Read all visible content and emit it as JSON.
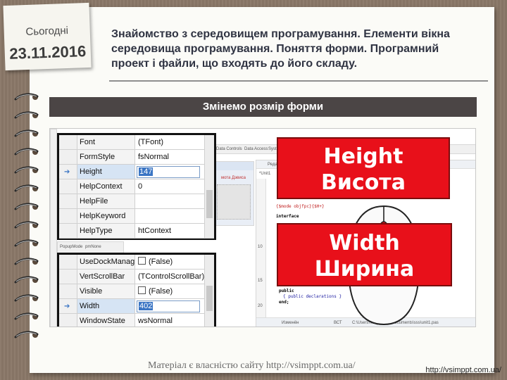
{
  "note": {
    "label": "Сьогодні",
    "date": "23.11.2016"
  },
  "title": "Знайомство з середовищем програмування. Елементи вікна середовища програмування. Поняття форми. Програмний проект і файли, що входять до його складу.",
  "subtitle": "Змінемо розмір форми",
  "inspector_top": {
    "rows": [
      {
        "name": "Font",
        "value": "(TFont)"
      },
      {
        "name": "FormStyle",
        "value": "fsNormal"
      },
      {
        "name": "Height",
        "value": "147",
        "selected": true
      },
      {
        "name": "HelpContext",
        "value": "0"
      },
      {
        "name": "HelpFile",
        "value": ""
      },
      {
        "name": "HelpKeyword",
        "value": ""
      },
      {
        "name": "HelpType",
        "value": "htContext"
      }
    ]
  },
  "inspector_bottom": {
    "rows": [
      {
        "name": "UseDockManag",
        "value": "(False)",
        "checkbox": true
      },
      {
        "name": "VertScrollBar",
        "value": "(TControlScrollBar)"
      },
      {
        "name": "Visible",
        "value": "(False)",
        "checkbox": true
      },
      {
        "name": "Width",
        "value": "402",
        "selected": true
      },
      {
        "name": "WindowState",
        "value": "wsNormal"
      }
    ]
  },
  "callouts": {
    "height": {
      "line1": "Height",
      "line2": "Висота"
    },
    "width": {
      "line1": "Width",
      "line2": "Ширина"
    }
  },
  "ide": {
    "tabs": [
      "Data Controls",
      "Data Access",
      "Syste"
    ],
    "popup_mode_label": "PopupMode",
    "popup_mode_value": "pmNone",
    "form_caption": "мота Дэвиса",
    "editor_caption": "Редакто",
    "unit_tab": "*Unit1",
    "code_lines": [
      "{$mode objfpc}{$H+}",
      "interface",
      "public",
      "{ public declarations }",
      "end;"
    ],
    "status_changed": "Изменён",
    "status_ins": "ВСТ",
    "status_path": "C:\\Users\\Vasyl\\Тора\\Documents\\sss\\unit1.pas",
    "line_numbers": [
      "10",
      "15",
      "20"
    ]
  },
  "footer": {
    "copyright": "Матеріал є власністю сайту http://vsimppt.com.ua/",
    "url": "http://vsimppt.com.ua/"
  }
}
